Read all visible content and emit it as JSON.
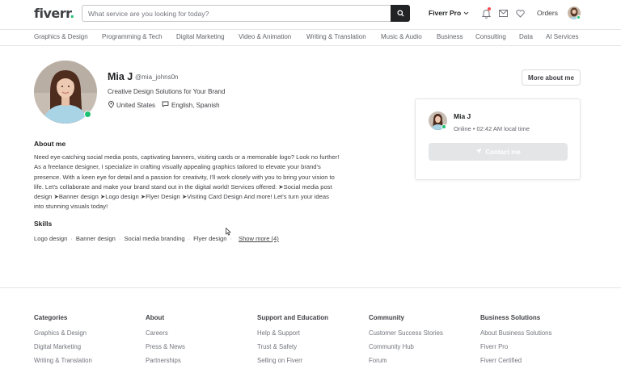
{
  "header": {
    "logo": "fiverr",
    "logo_dot": ".",
    "search_placeholder": "What service are you looking for today?",
    "pro_label": "Fiverr Pro",
    "orders_label": "Orders"
  },
  "categories_nav": [
    "Graphics & Design",
    "Programming & Tech",
    "Digital Marketing",
    "Video & Animation",
    "Writing & Translation",
    "Music & Audio",
    "Business",
    "Consulting",
    "Data",
    "AI Services"
  ],
  "profile": {
    "name": "Mia J",
    "handle": "@mia_johns0n",
    "tagline": "Creative Design Solutions for Your Brand",
    "country": "United States",
    "languages": "English, Spanish",
    "more_button": "More about me"
  },
  "contact_card": {
    "name": "Mia J",
    "status": "Online • 02:42 AM local time",
    "contact_button": "Contact me"
  },
  "about": {
    "heading": "About me",
    "text": "Need eye-catching social media posts, captivating banners, visiting cards or a memorable logo? Look no further! As a freelance designer, I specialize in crafting visually appealing graphics tailored to elevate your brand's presence. With a keen eye for detail and a passion for creativity, I'll work closely with you to bring your vision to life. Let's collaborate and make your brand stand out in the digital world! Services offered: ➤Social media post design ➤Banner design ➤Logo design ➤Flyer Design ➤Visiting Card Design And more! Let's turn your ideas into stunning visuals today!"
  },
  "skills": {
    "heading": "Skills",
    "items": [
      "Logo design",
      "Banner design",
      "Social media branding",
      "Flyer design"
    ],
    "show_more": "Show more (4)"
  },
  "footer": {
    "columns": [
      {
        "title": "Categories",
        "links": [
          "Graphics & Design",
          "Digital Marketing",
          "Writing & Translation"
        ]
      },
      {
        "title": "About",
        "links": [
          "Careers",
          "Press & News",
          "Partnerships"
        ]
      },
      {
        "title": "Support and Education",
        "links": [
          "Help & Support",
          "Trust & Safety",
          "Selling on Fiverr"
        ]
      },
      {
        "title": "Community",
        "links": [
          "Customer Success Stories",
          "Community Hub",
          "Forum"
        ]
      },
      {
        "title": "Business Solutions",
        "links": [
          "About Business Solutions",
          "Fiverr Pro",
          "Fiverr Certified"
        ]
      }
    ]
  },
  "colors": {
    "brand_green": "#1dbf73",
    "text_dark": "#222325",
    "text_body": "#404145",
    "text_muted": "#74767e",
    "search_button": "#222325",
    "disabled_button": "#e4e5e7"
  },
  "icons": [
    "search-icon",
    "chevron-down-icon",
    "bell-icon",
    "mail-icon",
    "heart-icon",
    "location-pin-icon",
    "chat-bubble-icon",
    "send-icon"
  ]
}
